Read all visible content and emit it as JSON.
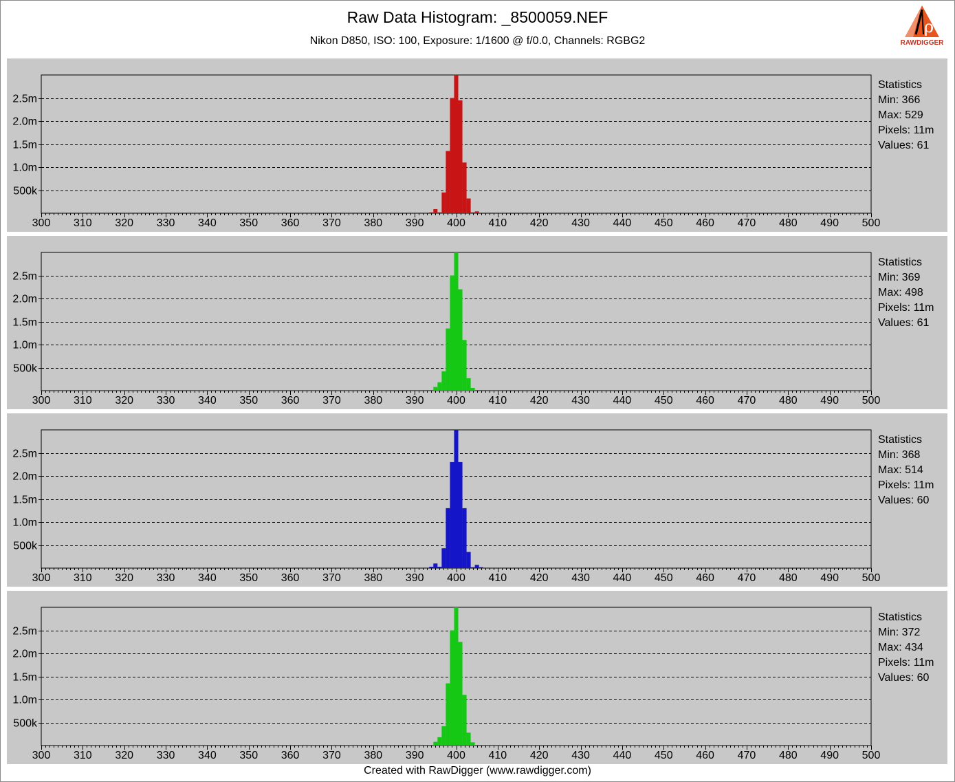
{
  "header": {
    "title": "Raw Data Histogram: _8500059.NEF",
    "subtitle": "Nikon D850, ISO: 100, Exposure: 1/1600 @ f/0.0, Channels: RGBG2",
    "logo_text": "RAWDIGGER"
  },
  "footer": {
    "text": "Created with RawDigger (www.rawdigger.com)"
  },
  "colors": {
    "panel_bg": "#c8c8c8",
    "grid": "#000000",
    "channels": [
      "#c81414",
      "#14c814",
      "#1414c8",
      "#14c814"
    ]
  },
  "chart_data": [
    {
      "type": "bar",
      "channel": "R",
      "xlim": [
        300,
        500
      ],
      "ylim": [
        0,
        3000000
      ],
      "x_ticks": [
        "300",
        "310",
        "320",
        "330",
        "340",
        "350",
        "360",
        "370",
        "380",
        "390",
        "400",
        "410",
        "420",
        "430",
        "440",
        "450",
        "460",
        "470",
        "480",
        "490",
        "500"
      ],
      "y_ticks": [
        {
          "value": 500000,
          "label": "500k"
        },
        {
          "value": 1000000,
          "label": "1.0m"
        },
        {
          "value": 1500000,
          "label": "1.5m"
        },
        {
          "value": 2000000,
          "label": "2.0m"
        },
        {
          "value": 2500000,
          "label": "2.5m"
        }
      ],
      "x": [
        394,
        395,
        396,
        397,
        398,
        399,
        400,
        401,
        402,
        403,
        404,
        405
      ],
      "values": [
        20000,
        90000,
        20000,
        450000,
        1350000,
        2500000,
        3000000,
        2450000,
        1100000,
        320000,
        20000,
        40000
      ],
      "statistics": {
        "heading": "Statistics",
        "min": "Min: 366",
        "max": "Max: 529",
        "pixels": "Pixels: 11m",
        "values": "Values: 61"
      }
    },
    {
      "type": "bar",
      "channel": "G",
      "xlim": [
        300,
        500
      ],
      "ylim": [
        0,
        3000000
      ],
      "x_ticks": [
        "300",
        "310",
        "320",
        "330",
        "340",
        "350",
        "360",
        "370",
        "380",
        "390",
        "400",
        "410",
        "420",
        "430",
        "440",
        "450",
        "460",
        "470",
        "480",
        "490",
        "500"
      ],
      "y_ticks": [
        {
          "value": 500000,
          "label": "500k"
        },
        {
          "value": 1000000,
          "label": "1.0m"
        },
        {
          "value": 1500000,
          "label": "1.5m"
        },
        {
          "value": 2000000,
          "label": "2.0m"
        },
        {
          "value": 2500000,
          "label": "2.5m"
        }
      ],
      "x": [
        395,
        396,
        397,
        398,
        399,
        400,
        401,
        402,
        403,
        404
      ],
      "values": [
        80000,
        180000,
        420000,
        1350000,
        2500000,
        3000000,
        2200000,
        1100000,
        270000,
        60000
      ],
      "statistics": {
        "heading": "Statistics",
        "min": "Min: 369",
        "max": "Max: 498",
        "pixels": "Pixels: 11m",
        "values": "Values: 61"
      }
    },
    {
      "type": "bar",
      "channel": "B",
      "xlim": [
        300,
        500
      ],
      "ylim": [
        0,
        3000000
      ],
      "x_ticks": [
        "300",
        "310",
        "320",
        "330",
        "340",
        "350",
        "360",
        "370",
        "380",
        "390",
        "400",
        "410",
        "420",
        "430",
        "440",
        "450",
        "460",
        "470",
        "480",
        "490",
        "500"
      ],
      "y_ticks": [
        {
          "value": 500000,
          "label": "500k"
        },
        {
          "value": 1000000,
          "label": "1.0m"
        },
        {
          "value": 1500000,
          "label": "1.5m"
        },
        {
          "value": 2000000,
          "label": "2.0m"
        },
        {
          "value": 2500000,
          "label": "2.5m"
        }
      ],
      "x": [
        394,
        395,
        396,
        397,
        398,
        399,
        400,
        401,
        402,
        403,
        404,
        405,
        406
      ],
      "values": [
        30000,
        100000,
        30000,
        430000,
        1300000,
        2300000,
        3000000,
        2300000,
        1300000,
        350000,
        20000,
        70000,
        20000
      ],
      "statistics": {
        "heading": "Statistics",
        "min": "Min: 368",
        "max": "Max: 514",
        "pixels": "Pixels: 11m",
        "values": "Values: 60"
      }
    },
    {
      "type": "bar",
      "channel": "G2",
      "xlim": [
        300,
        500
      ],
      "ylim": [
        0,
        3000000
      ],
      "x_ticks": [
        "300",
        "310",
        "320",
        "330",
        "340",
        "350",
        "360",
        "370",
        "380",
        "390",
        "400",
        "410",
        "420",
        "430",
        "440",
        "450",
        "460",
        "470",
        "480",
        "490",
        "500"
      ],
      "y_ticks": [
        {
          "value": 500000,
          "label": "500k"
        },
        {
          "value": 1000000,
          "label": "1.0m"
        },
        {
          "value": 1500000,
          "label": "1.5m"
        },
        {
          "value": 2000000,
          "label": "2.0m"
        },
        {
          "value": 2500000,
          "label": "2.5m"
        }
      ],
      "x": [
        395,
        396,
        397,
        398,
        399,
        400,
        401,
        402,
        403,
        404
      ],
      "values": [
        80000,
        180000,
        420000,
        1350000,
        2500000,
        3000000,
        2250000,
        1100000,
        280000,
        70000
      ],
      "statistics": {
        "heading": "Statistics",
        "min": "Min: 372",
        "max": "Max: 434",
        "pixels": "Pixels: 11m",
        "values": "Values: 60"
      }
    }
  ]
}
